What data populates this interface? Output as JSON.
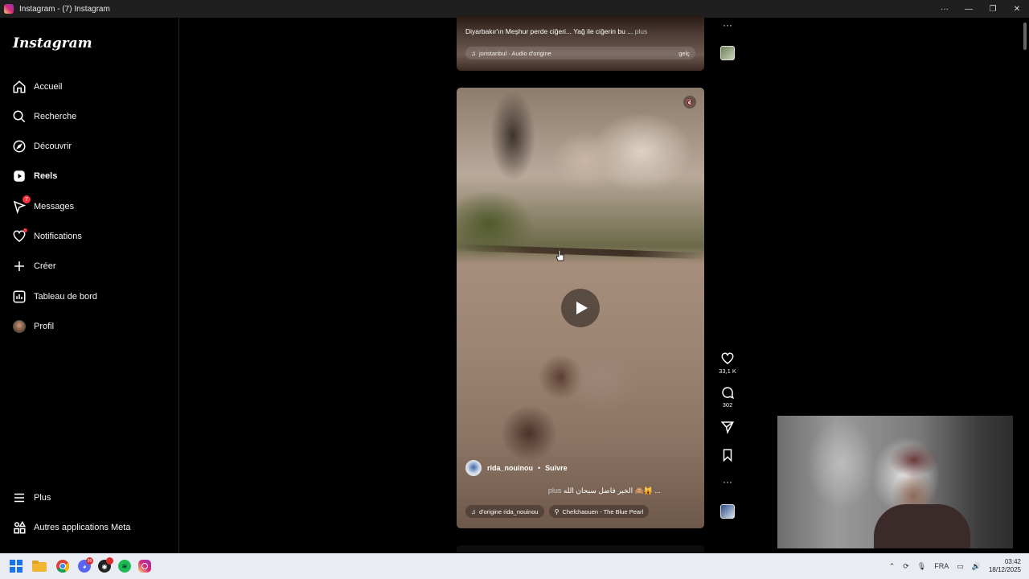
{
  "window": {
    "title": "Instagram - (7) Instagram",
    "controls": [
      "more-icon",
      "minimize-icon",
      "restore-icon",
      "close-icon"
    ]
  },
  "sidebar": {
    "logo": "Instagram",
    "items": [
      {
        "label": "Accueil",
        "icon": "home-icon"
      },
      {
        "label": "Recherche",
        "icon": "search-icon"
      },
      {
        "label": "Découvrir",
        "icon": "compass-icon"
      },
      {
        "label": "Reels",
        "icon": "reels-icon",
        "active": true
      },
      {
        "label": "Messages",
        "icon": "messenger-icon",
        "badge": "7"
      },
      {
        "label": "Notifications",
        "icon": "heart-icon",
        "dot": true
      },
      {
        "label": "Créer",
        "icon": "plus-icon"
      },
      {
        "label": "Tableau de bord",
        "icon": "dashboard-icon"
      },
      {
        "label": "Profil",
        "icon": "avatar"
      }
    ],
    "bottom": [
      {
        "label": "Plus",
        "icon": "menu-icon"
      },
      {
        "label": "Autres applications Meta",
        "icon": "meta-apps-icon"
      }
    ]
  },
  "previous_reel": {
    "caption": "Diyarbakır'ın Meşhur perde ciğeri... Yağ ile ciğerin bu ...",
    "more": "plus",
    "audio": "joristanbul · Audio d'origine",
    "audio_right": "gelç"
  },
  "reel": {
    "author": "rida_nouinou",
    "separator": "•",
    "follow": "Suivre",
    "caption": "الخير فاضل سبحان الله 🙈🙀 ...",
    "more": "plus",
    "audio_tag": "d'origine  rida_nouinou",
    "location_tag": "Chefchaouen - The Blue Pearl"
  },
  "actions": {
    "likes": "33,1 K",
    "comments": "302"
  },
  "taskbar": {
    "language": "FRA",
    "time": "03:42",
    "date": "18/12/2025",
    "discord_badge": "99"
  },
  "colors": {
    "background": "#000000",
    "badge": "#ff3040",
    "taskbar": "#e9edf3"
  }
}
